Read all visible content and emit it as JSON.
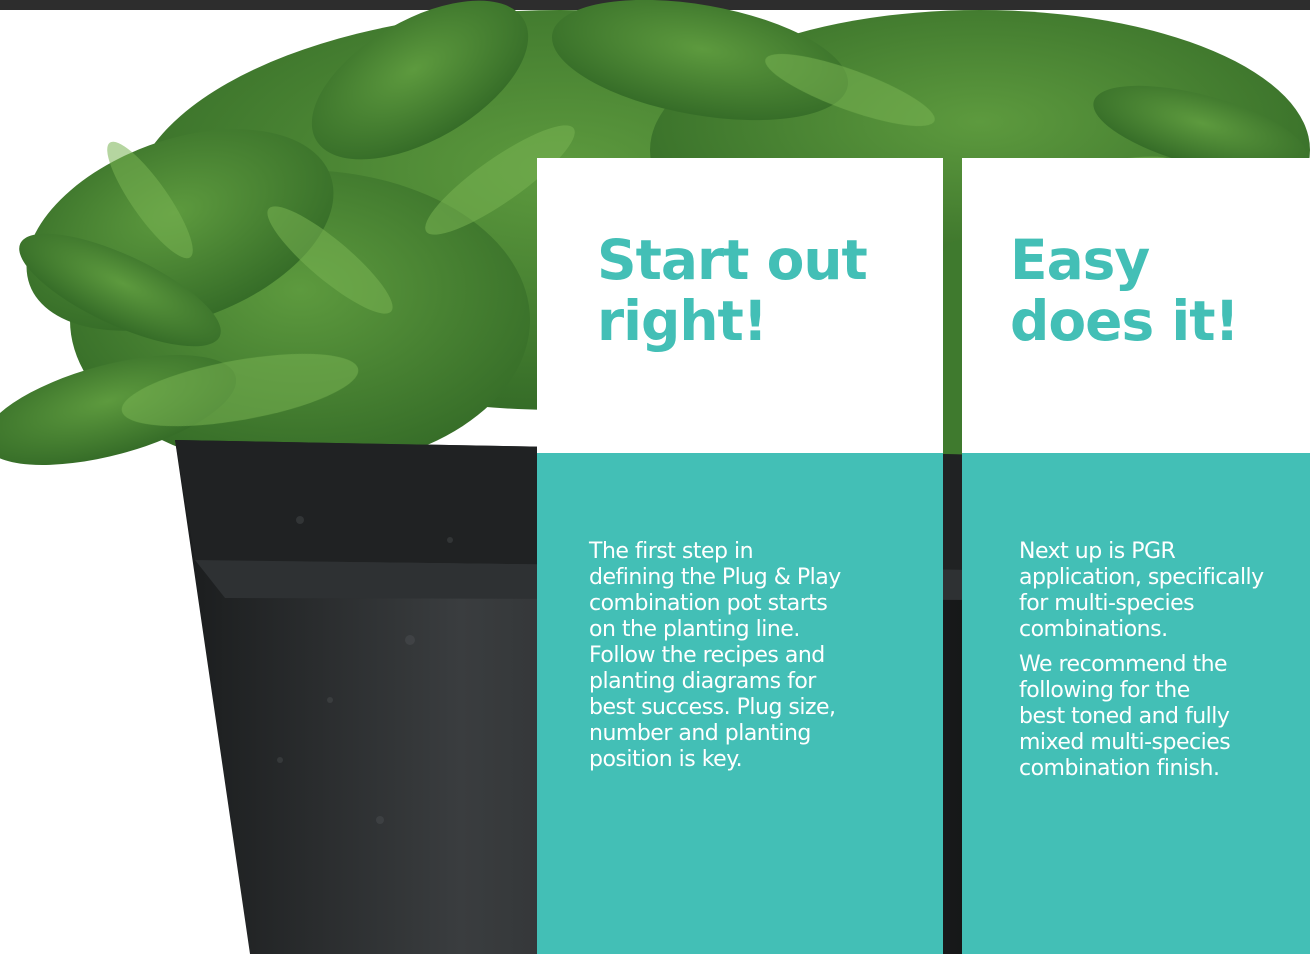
{
  "colors": {
    "accent": "#43bfb6",
    "title_band": "#ffffff",
    "top_banner": "#2d2d2d"
  },
  "cards": [
    {
      "title": "Start out\nright!",
      "paragraphs": [
        "The first step in\ndefining the Plug & Play\ncombination pot starts\non the planting line.\nFollow the recipes and\nplanting diagrams for\nbest success. Plug size,\nnumber and planting\nposition is key."
      ]
    },
    {
      "title": "Easy\ndoes it!",
      "paragraphs": [
        "Next up is PGR\napplication, specifically\nfor multi-species\ncombinations.",
        "We recommend the\nfollowing for the\nbest toned and fully\nmixed multi-species\ncombination finish."
      ]
    }
  ]
}
